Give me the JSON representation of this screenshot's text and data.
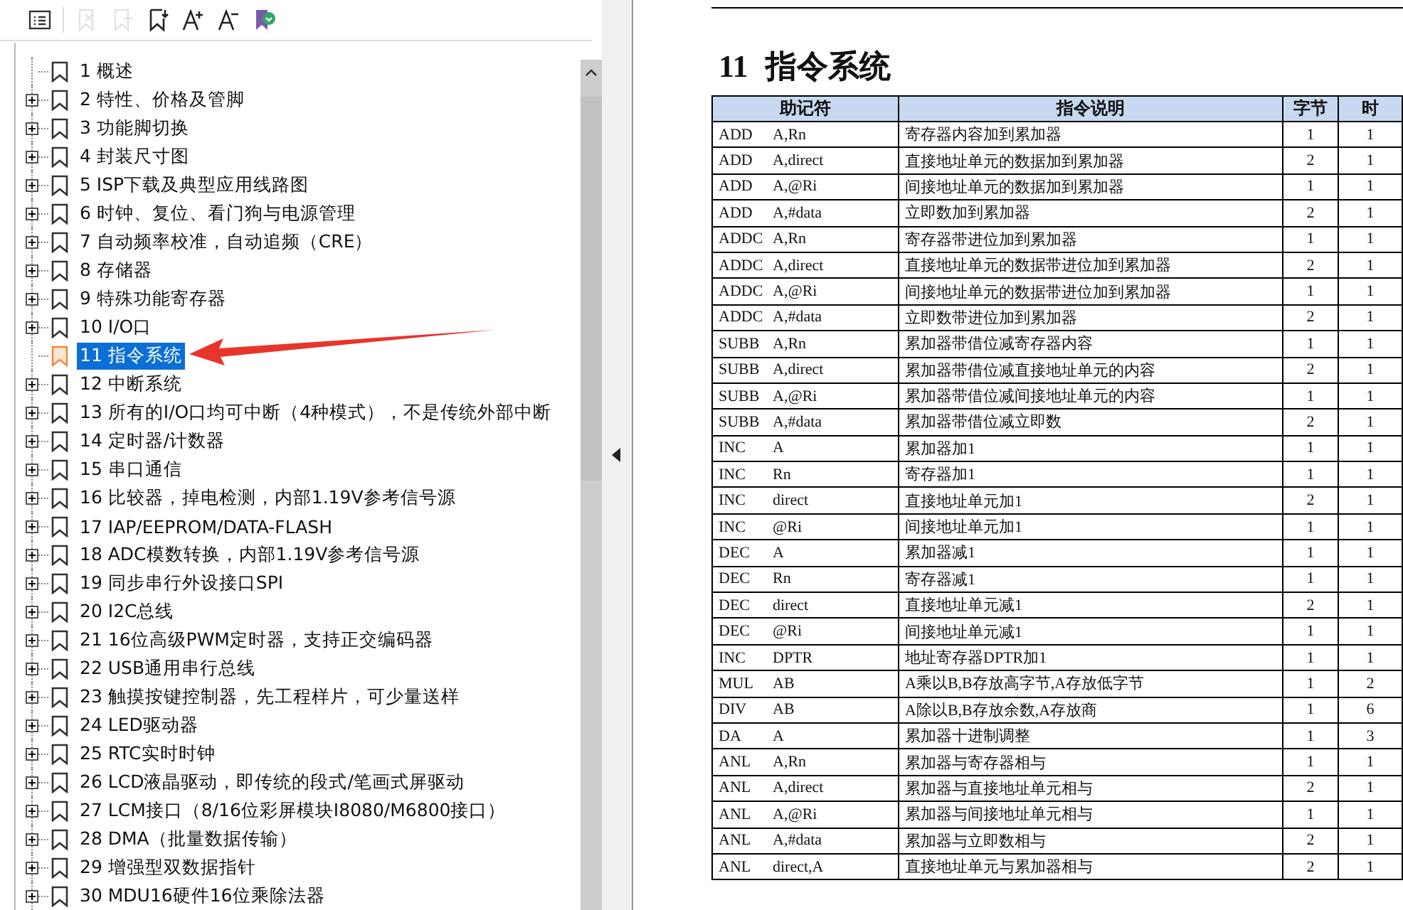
{
  "toolbar": {
    "buttons": [
      {
        "kind": "outline",
        "disabled": false
      },
      {
        "kind": "delete-bookmark",
        "disabled": true
      },
      {
        "kind": "add-bookmark",
        "disabled": true
      },
      {
        "kind": "bookmark-down",
        "disabled": false
      },
      {
        "kind": "font-larger",
        "disabled": false
      },
      {
        "kind": "font-smaller",
        "disabled": false
      },
      {
        "kind": "tag-bookmark",
        "disabled": false
      }
    ]
  },
  "bookmarks": [
    {
      "label": "1 概述",
      "expandable": false,
      "selected": false
    },
    {
      "label": "2 特性、价格及管脚",
      "expandable": true,
      "selected": false
    },
    {
      "label": "3 功能脚切换",
      "expandable": true,
      "selected": false
    },
    {
      "label": "4 封装尺寸图",
      "expandable": true,
      "selected": false
    },
    {
      "label": "5 ISP下载及典型应用线路图",
      "expandable": true,
      "selected": false
    },
    {
      "label": "6 时钟、复位、看门狗与电源管理",
      "expandable": true,
      "selected": false
    },
    {
      "label": "7 自动频率校准，自动追频（CRE）",
      "expandable": true,
      "selected": false
    },
    {
      "label": "8 存储器",
      "expandable": true,
      "selected": false
    },
    {
      "label": "9 特殊功能寄存器",
      "expandable": true,
      "selected": false
    },
    {
      "label": "10 I/O口",
      "expandable": true,
      "selected": false
    },
    {
      "label": "11 指令系统",
      "expandable": false,
      "selected": true
    },
    {
      "label": "12 中断系统",
      "expandable": true,
      "selected": false
    },
    {
      "label": "13 所有的I/O口均可中断（4种模式），不是传统外部中断",
      "expandable": true,
      "selected": false
    },
    {
      "label": "14 定时器/计数器",
      "expandable": true,
      "selected": false
    },
    {
      "label": "15 串口通信",
      "expandable": true,
      "selected": false
    },
    {
      "label": "16 比较器，掉电检测，内部1.19V参考信号源",
      "expandable": true,
      "selected": false
    },
    {
      "label": "17 IAP/EEPROM/DATA-FLASH",
      "expandable": true,
      "selected": false
    },
    {
      "label": "18 ADC模数转换，内部1.19V参考信号源",
      "expandable": true,
      "selected": false
    },
    {
      "label": "19 同步串行外设接口SPI",
      "expandable": true,
      "selected": false
    },
    {
      "label": "20 I2C总线",
      "expandable": true,
      "selected": false
    },
    {
      "label": "21 16位高级PWM定时器，支持正交编码器",
      "expandable": true,
      "selected": false
    },
    {
      "label": "22 USB通用串行总线",
      "expandable": true,
      "selected": false
    },
    {
      "label": "23 触摸按键控制器，先工程样片，可少量送样",
      "expandable": true,
      "selected": false
    },
    {
      "label": "24 LED驱动器",
      "expandable": true,
      "selected": false
    },
    {
      "label": "25 RTC实时时钟",
      "expandable": true,
      "selected": false
    },
    {
      "label": "26 LCD液晶驱动，即传统的段式/笔画式屏驱动",
      "expandable": true,
      "selected": false
    },
    {
      "label": "27 LCM接口（8/16位彩屏模块I8080/M6800接口）",
      "expandable": true,
      "selected": false
    },
    {
      "label": "28 DMA（批量数据传输）",
      "expandable": true,
      "selected": false
    },
    {
      "label": "29 增强型双数据指针",
      "expandable": true,
      "selected": false
    },
    {
      "label": "30 MDU16硬件16位乘除法器",
      "expandable": true,
      "selected": false
    }
  ],
  "document": {
    "heading_number": "11",
    "heading_title": "指令系统",
    "table": {
      "columns": [
        "助记符",
        "指令说明",
        "字节",
        "时"
      ],
      "rows": [
        [
          {
            "op": "ADD",
            "operand": "A,Rn"
          },
          "寄存器内容加到累加器",
          "1",
          "1"
        ],
        [
          {
            "op": "ADD",
            "operand": "A,direct"
          },
          "直接地址单元的数据加到累加器",
          "2",
          "1"
        ],
        [
          {
            "op": "ADD",
            "operand": "A,@Ri"
          },
          "间接地址单元的数据加到累加器",
          "1",
          "1"
        ],
        [
          {
            "op": "ADD",
            "operand": "A,#data"
          },
          "立即数加到累加器",
          "2",
          "1"
        ],
        [
          {
            "op": "ADDC",
            "operand": "A,Rn"
          },
          "寄存器带进位加到累加器",
          "1",
          "1"
        ],
        [
          {
            "op": "ADDC",
            "operand": "A,direct"
          },
          "直接地址单元的数据带进位加到累加器",
          "2",
          "1"
        ],
        [
          {
            "op": "ADDC",
            "operand": "A,@Ri"
          },
          "间接地址单元的数据带进位加到累加器",
          "1",
          "1"
        ],
        [
          {
            "op": "ADDC",
            "operand": "A,#data"
          },
          "立即数带进位加到累加器",
          "2",
          "1"
        ],
        [
          {
            "op": "SUBB",
            "operand": "A,Rn"
          },
          "累加器带借位减寄存器内容",
          "1",
          "1"
        ],
        [
          {
            "op": "SUBB",
            "operand": "A,direct"
          },
          "累加器带借位减直接地址单元的内容",
          "2",
          "1"
        ],
        [
          {
            "op": "SUBB",
            "operand": "A,@Ri"
          },
          "累加器带借位减间接地址单元的内容",
          "1",
          "1"
        ],
        [
          {
            "op": "SUBB",
            "operand": "A,#data"
          },
          "累加器带借位减立即数",
          "2",
          "1"
        ],
        [
          {
            "op": "INC",
            "operand": "A"
          },
          "累加器加1",
          "1",
          "1"
        ],
        [
          {
            "op": "INC",
            "operand": "Rn"
          },
          "寄存器加1",
          "1",
          "1"
        ],
        [
          {
            "op": "INC",
            "operand": "direct"
          },
          "直接地址单元加1",
          "2",
          "1"
        ],
        [
          {
            "op": "INC",
            "operand": "@Ri"
          },
          "间接地址单元加1",
          "1",
          "1"
        ],
        [
          {
            "op": "DEC",
            "operand": "A"
          },
          "累加器减1",
          "1",
          "1"
        ],
        [
          {
            "op": "DEC",
            "operand": "Rn"
          },
          "寄存器减1",
          "1",
          "1"
        ],
        [
          {
            "op": "DEC",
            "operand": "direct"
          },
          "直接地址单元减1",
          "2",
          "1"
        ],
        [
          {
            "op": "DEC",
            "operand": "@Ri"
          },
          "间接地址单元减1",
          "1",
          "1"
        ],
        [
          {
            "op": "INC",
            "operand": "DPTR"
          },
          "地址寄存器DPTR加1",
          "1",
          "1"
        ],
        [
          {
            "op": "MUL",
            "operand": "AB"
          },
          "A乘以B,B存放高字节,A存放低字节",
          "1",
          "2"
        ],
        [
          {
            "op": "DIV",
            "operand": "AB"
          },
          "A除以B,B存放余数,A存放商",
          "1",
          "6"
        ],
        [
          {
            "op": "DA",
            "operand": "A"
          },
          "累加器十进制调整",
          "1",
          "3"
        ],
        [
          {
            "op": "ANL",
            "operand": "A,Rn"
          },
          "累加器与寄存器相与",
          "1",
          "1"
        ],
        [
          {
            "op": "ANL",
            "operand": "A,direct"
          },
          "累加器与直接地址单元相与",
          "2",
          "1"
        ],
        [
          {
            "op": "ANL",
            "operand": "A,@Ri"
          },
          "累加器与间接地址单元相与",
          "1",
          "1"
        ],
        [
          {
            "op": "ANL",
            "operand": "A,#data"
          },
          "累加器与立即数相与",
          "2",
          "1"
        ],
        [
          {
            "op": "ANL",
            "operand": "direct,A"
          },
          "直接地址单元与累加器相与",
          "2",
          "1"
        ]
      ]
    }
  }
}
